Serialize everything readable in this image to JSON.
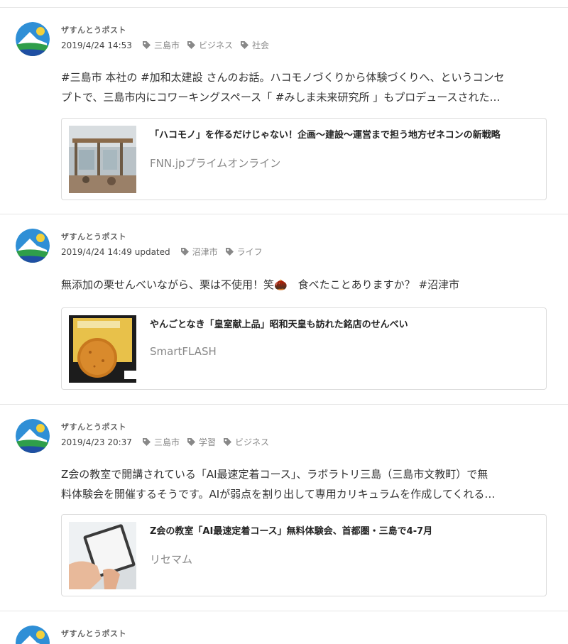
{
  "posts": [
    {
      "author": "ザすんとうポスト",
      "date": "2019/4/24 14:53",
      "tags": [
        "三島市",
        "ビジネス",
        "社会"
      ],
      "text_lines": [
        "#三島市 本社の #加和太建設 さんのお話。ハコモノづくりから体験づくりへ、というコンセ",
        "プトで、三島市内にコワーキングスペース「 #みしま未来研究所 」もプロデュースされた…"
      ],
      "card": {
        "title": "「ハコモノ」を作るだけじゃない！企画〜建設〜運営まで担う地方ゼネコンの新戦略",
        "source": "FNN.jpプライムオンライン"
      }
    },
    {
      "author": "ザすんとうポスト",
      "date": "2019/4/24 14:49 updated",
      "tags": [
        "沼津市",
        "ライフ"
      ],
      "text_lines": [
        "無添加の栗せんべいながら、栗は不使用！笑🌰　食べたことありますか？ #沼津市"
      ],
      "card": {
        "title": "やんごとなき「皇室献上品」昭和天皇も訪れた銘店のせんべい",
        "source": "SmartFLASH"
      }
    },
    {
      "author": "ザすんとうポスト",
      "date": "2019/4/23 20:37",
      "tags": [
        "三島市",
        "学習",
        "ビジネス"
      ],
      "text_lines": [
        "Z会の教室で開講されている「AI最速定着コース」、ラボラトリ三島（三島市文教町）で無",
        "料体験会を開催するそうです。AIが弱点を割り出して専用カリキュラムを作成してくれる…"
      ],
      "card": {
        "title": "Z会の教室「AI最速定着コース」無料体験会、首都圏・三島で4-7月",
        "source": "リセマム"
      }
    },
    {
      "author": "ザすんとうポスト"
    }
  ]
}
